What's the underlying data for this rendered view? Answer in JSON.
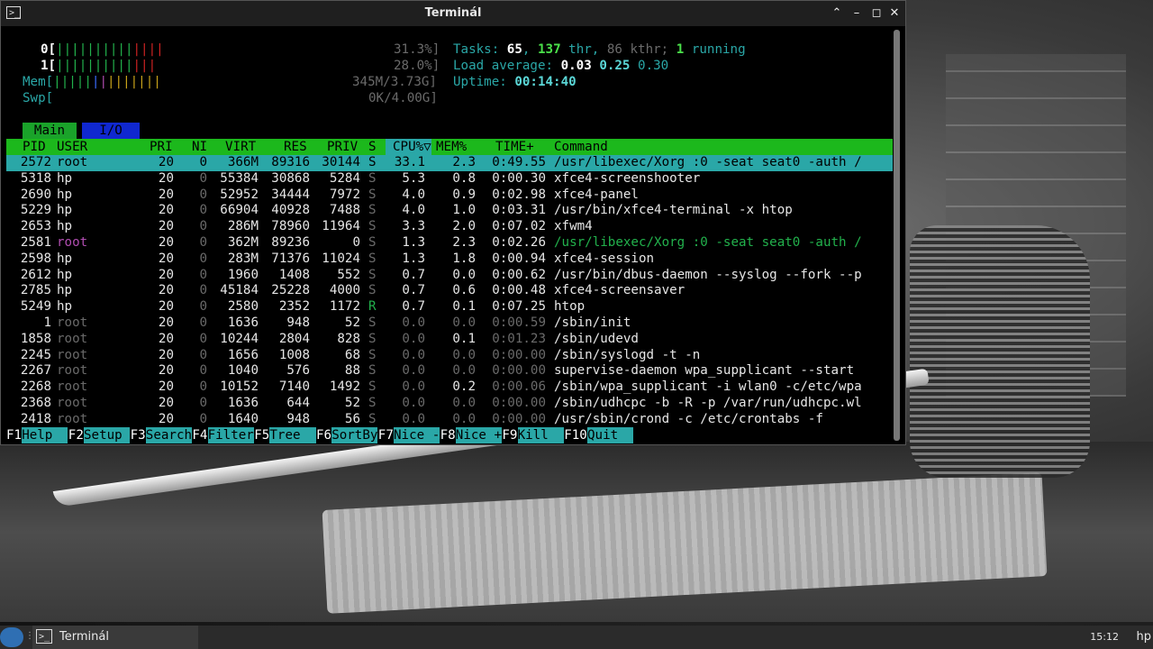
{
  "window": {
    "title": "Terminál",
    "icon": "terminal-icon"
  },
  "meters": {
    "cpu0": {
      "label": "0[",
      "bars_g": "||||||||||",
      "bars_r": "||||",
      "value": "31.3%]"
    },
    "cpu1": {
      "label": "1[",
      "bars_g": "||||||||||",
      "bars_r": "|||",
      "value": "28.0%]"
    },
    "mem": {
      "label": "Mem[",
      "bars_g": "|||||",
      "bars_b": "|",
      "bars_m": "|",
      "bars_o": "|||||||",
      "value": "345M/3.73G]"
    },
    "swp": {
      "label": "Swp[",
      "value": "0K/4.00G]"
    }
  },
  "summary": {
    "tasks_label": "Tasks: ",
    "tasks": "65",
    "sep1": ", ",
    "thr": "137",
    "thr_label": " thr, ",
    "kthr": "86 kthr; ",
    "running": "1",
    "running_label": " running",
    "load_label": "Load average: ",
    "load1": "0.03",
    "load5": "0.25",
    "load15": "0.30",
    "uptime_label": "Uptime: ",
    "uptime": "00:14:40"
  },
  "tabs": {
    "main": "Main",
    "io": "I/O"
  },
  "columns": [
    "PID",
    "USER",
    "PRI",
    "NI",
    "VIRT",
    "RES",
    "PRIV",
    "S",
    "CPU%▽",
    "MEM%",
    "TIME+",
    "Command"
  ],
  "processes": [
    {
      "pid": "2572",
      "user": "root",
      "pri": "20",
      "ni": "0",
      "virt": "366M",
      "res": "89316",
      "priv": "30144",
      "s": "S",
      "cpu": "33.1",
      "mem": "2.3",
      "time": "0:49.55",
      "cmd": "/usr/libexec/Xorg :0 -seat seat0 -auth /"
    },
    {
      "pid": "5318",
      "user": "hp",
      "pri": "20",
      "ni": "0",
      "virt": "55384",
      "res": "30868",
      "priv": "5284",
      "s": "S",
      "cpu": "5.3",
      "mem": "0.8",
      "time": "0:00.30",
      "cmd": "xfce4-screenshooter"
    },
    {
      "pid": "2690",
      "user": "hp",
      "pri": "20",
      "ni": "0",
      "virt": "52952",
      "res": "34444",
      "priv": "7972",
      "s": "S",
      "cpu": "4.0",
      "mem": "0.9",
      "time": "0:02.98",
      "cmd": "xfce4-panel"
    },
    {
      "pid": "5229",
      "user": "hp",
      "pri": "20",
      "ni": "0",
      "virt": "66904",
      "res": "40928",
      "priv": "7488",
      "s": "S",
      "cpu": "4.0",
      "mem": "1.0",
      "time": "0:03.31",
      "cmd": "/usr/bin/xfce4-terminal -x htop"
    },
    {
      "pid": "2653",
      "user": "hp",
      "pri": "20",
      "ni": "0",
      "virt": "286M",
      "res": "78960",
      "priv": "11964",
      "s": "S",
      "cpu": "3.3",
      "mem": "2.0",
      "time": "0:07.02",
      "cmd": "xfwm4"
    },
    {
      "pid": "2581",
      "user": "root",
      "pri": "20",
      "ni": "0",
      "virt": "362M",
      "res": "89236",
      "priv": "0",
      "s": "S",
      "cpu": "1.3",
      "mem": "2.3",
      "time": "0:02.26",
      "cmd": "/usr/libexec/Xorg :0 -seat seat0 -auth /"
    },
    {
      "pid": "2598",
      "user": "hp",
      "pri": "20",
      "ni": "0",
      "virt": "283M",
      "res": "71376",
      "priv": "11024",
      "s": "S",
      "cpu": "1.3",
      "mem": "1.8",
      "time": "0:00.94",
      "cmd": "xfce4-session"
    },
    {
      "pid": "2612",
      "user": "hp",
      "pri": "20",
      "ni": "0",
      "virt": "1960",
      "res": "1408",
      "priv": "552",
      "s": "S",
      "cpu": "0.7",
      "mem": "0.0",
      "time": "0:00.62",
      "cmd": "/usr/bin/dbus-daemon --syslog --fork --p"
    },
    {
      "pid": "2785",
      "user": "hp",
      "pri": "20",
      "ni": "0",
      "virt": "45184",
      "res": "25228",
      "priv": "4000",
      "s": "S",
      "cpu": "0.7",
      "mem": "0.6",
      "time": "0:00.48",
      "cmd": "xfce4-screensaver"
    },
    {
      "pid": "5249",
      "user": "hp",
      "pri": "20",
      "ni": "0",
      "virt": "2580",
      "res": "2352",
      "priv": "1172",
      "s": "R",
      "cpu": "0.7",
      "mem": "0.1",
      "time": "0:07.25",
      "cmd": "htop"
    },
    {
      "pid": "1",
      "user": "root",
      "pri": "20",
      "ni": "0",
      "virt": "1636",
      "res": "948",
      "priv": "52",
      "s": "S",
      "cpu": "0.0",
      "mem": "0.0",
      "time": "0:00.59",
      "cmd": "/sbin/init"
    },
    {
      "pid": "1858",
      "user": "root",
      "pri": "20",
      "ni": "0",
      "virt": "10244",
      "res": "2804",
      "priv": "828",
      "s": "S",
      "cpu": "0.0",
      "mem": "0.1",
      "time": "0:01.23",
      "cmd": "/sbin/udevd"
    },
    {
      "pid": "2245",
      "user": "root",
      "pri": "20",
      "ni": "0",
      "virt": "1656",
      "res": "1008",
      "priv": "68",
      "s": "S",
      "cpu": "0.0",
      "mem": "0.0",
      "time": "0:00.00",
      "cmd": "/sbin/syslogd -t -n"
    },
    {
      "pid": "2267",
      "user": "root",
      "pri": "20",
      "ni": "0",
      "virt": "1040",
      "res": "576",
      "priv": "88",
      "s": "S",
      "cpu": "0.0",
      "mem": "0.0",
      "time": "0:00.00",
      "cmd": "supervise-daemon wpa_supplicant --start"
    },
    {
      "pid": "2268",
      "user": "root",
      "pri": "20",
      "ni": "0",
      "virt": "10152",
      "res": "7140",
      "priv": "1492",
      "s": "S",
      "cpu": "0.0",
      "mem": "0.2",
      "time": "0:00.06",
      "cmd": "/sbin/wpa_supplicant -i wlan0 -c/etc/wpa"
    },
    {
      "pid": "2368",
      "user": "root",
      "pri": "20",
      "ni": "0",
      "virt": "1636",
      "res": "644",
      "priv": "52",
      "s": "S",
      "cpu": "0.0",
      "mem": "0.0",
      "time": "0:00.00",
      "cmd": "/sbin/udhcpc -b -R -p /var/run/udhcpc.wl"
    },
    {
      "pid": "2418",
      "user": "root",
      "pri": "20",
      "ni": "0",
      "virt": "1640",
      "res": "948",
      "priv": "56",
      "s": "S",
      "cpu": "0.0",
      "mem": "0.0",
      "time": "0:00.00",
      "cmd": "/usr/sbin/crond -c /etc/crontabs -f"
    }
  ],
  "fkeys": [
    {
      "key": "F1",
      "label": "Help  "
    },
    {
      "key": "F2",
      "label": "Setup "
    },
    {
      "key": "F3",
      "label": "Search"
    },
    {
      "key": "F4",
      "label": "Filter"
    },
    {
      "key": "F5",
      "label": "Tree  "
    },
    {
      "key": "F6",
      "label": "SortBy"
    },
    {
      "key": "F7",
      "label": "Nice -"
    },
    {
      "key": "F8",
      "label": "Nice +"
    },
    {
      "key": "F9",
      "label": "Kill  "
    },
    {
      "key": "F10",
      "label": "Quit  "
    }
  ],
  "taskbar": {
    "task_label": "Terminál",
    "clock": "15:12",
    "user": "hp"
  },
  "colors": {
    "header_green": "#1cb81c",
    "selection_cyan": "#2aa7a7",
    "titlebar": "#1f1f1f"
  }
}
